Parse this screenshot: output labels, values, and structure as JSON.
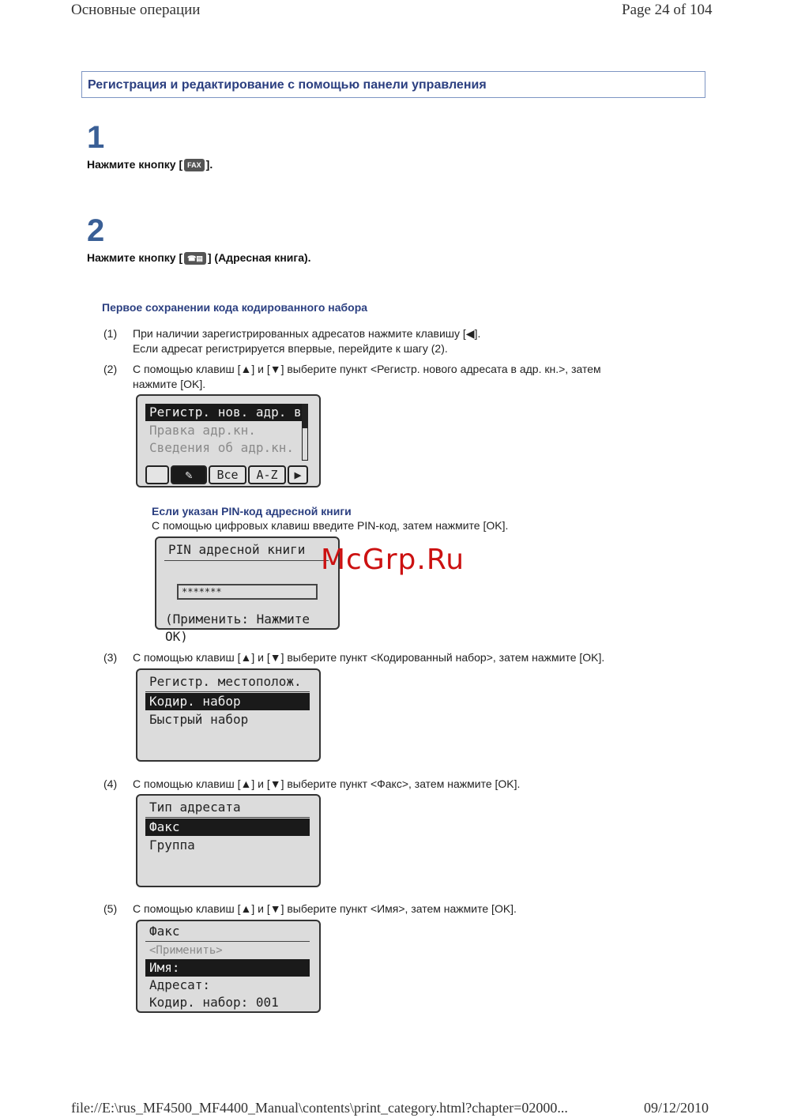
{
  "header": {
    "left": "Основные операции",
    "right": "Page 24 of 104"
  },
  "section_title": "Регистрация и редактирование с помощью панели управления",
  "steps": [
    {
      "number": "1",
      "text_before": "Нажмите кнопку [",
      "icon": "FAX",
      "text_after": "]."
    },
    {
      "number": "2",
      "text_before": "Нажмите кнопку [",
      "icon": "☎▤",
      "text_after": "] (Адресная книга)."
    }
  ],
  "sub_heading": "Первое сохранении кода кодированного набора",
  "items": [
    {
      "num": "(1)",
      "line1": "При наличии зарегистрированных адресатов нажмите клавишу [◀].",
      "line2": "Если адресат регистрируется впервые, перейдите к шагу (2)."
    },
    {
      "num": "(2)",
      "line1": "С помощью клавиш [▲] и [▼] выберите пункт <Регистр. нового адресата в адр. кн.>, затем",
      "line2": "нажмите [OK]."
    },
    {
      "num": "(3)",
      "line1": "С помощью клавиш [▲] и [▼] выберите пункт <Кодированный набор>, затем нажмите [OK]."
    },
    {
      "num": "(4)",
      "line1": "С помощью клавиш [▲] и [▼] выберите пункт <Факс>, затем нажмите [OK]."
    },
    {
      "num": "(5)",
      "line1": "С помощью клавиш [▲] и [▼] выберите пункт <Имя>, затем нажмите [OK]."
    }
  ],
  "pin_note": {
    "title": "Если указан PIN-код адресной книги",
    "text": "С помощью цифровых клавиш введите PIN-код, затем нажмите [OK]."
  },
  "screens": {
    "s1": {
      "rows": [
        "Регистр. нов. адр. в",
        "Правка адр.кн.",
        "Сведения об адр.кн."
      ],
      "softkeys": [
        "",
        "✎",
        "Все",
        "A-Z",
        "▶"
      ]
    },
    "pin": {
      "title": "PIN адресной книги",
      "value": "*******",
      "footer": "(Применить: Нажмите OK)"
    },
    "s3": {
      "title": "Регистр. местополож.",
      "rows": [
        "Кодир. набор",
        "Быстрый набор"
      ]
    },
    "s4": {
      "title": "Тип адресата",
      "rows": [
        "Факс",
        "Группа"
      ]
    },
    "s5": {
      "title": "Факс",
      "rows": [
        "<Применить>",
        "Имя:",
        "Адресат:",
        "Кодир. набор: 001"
      ]
    }
  },
  "watermark": "McGrp.Ru",
  "footer": {
    "left": "file://E:\\rus_MF4500_MF4400_Manual\\contents\\print_category.html?chapter=02000...",
    "right": "09/12/2010"
  }
}
